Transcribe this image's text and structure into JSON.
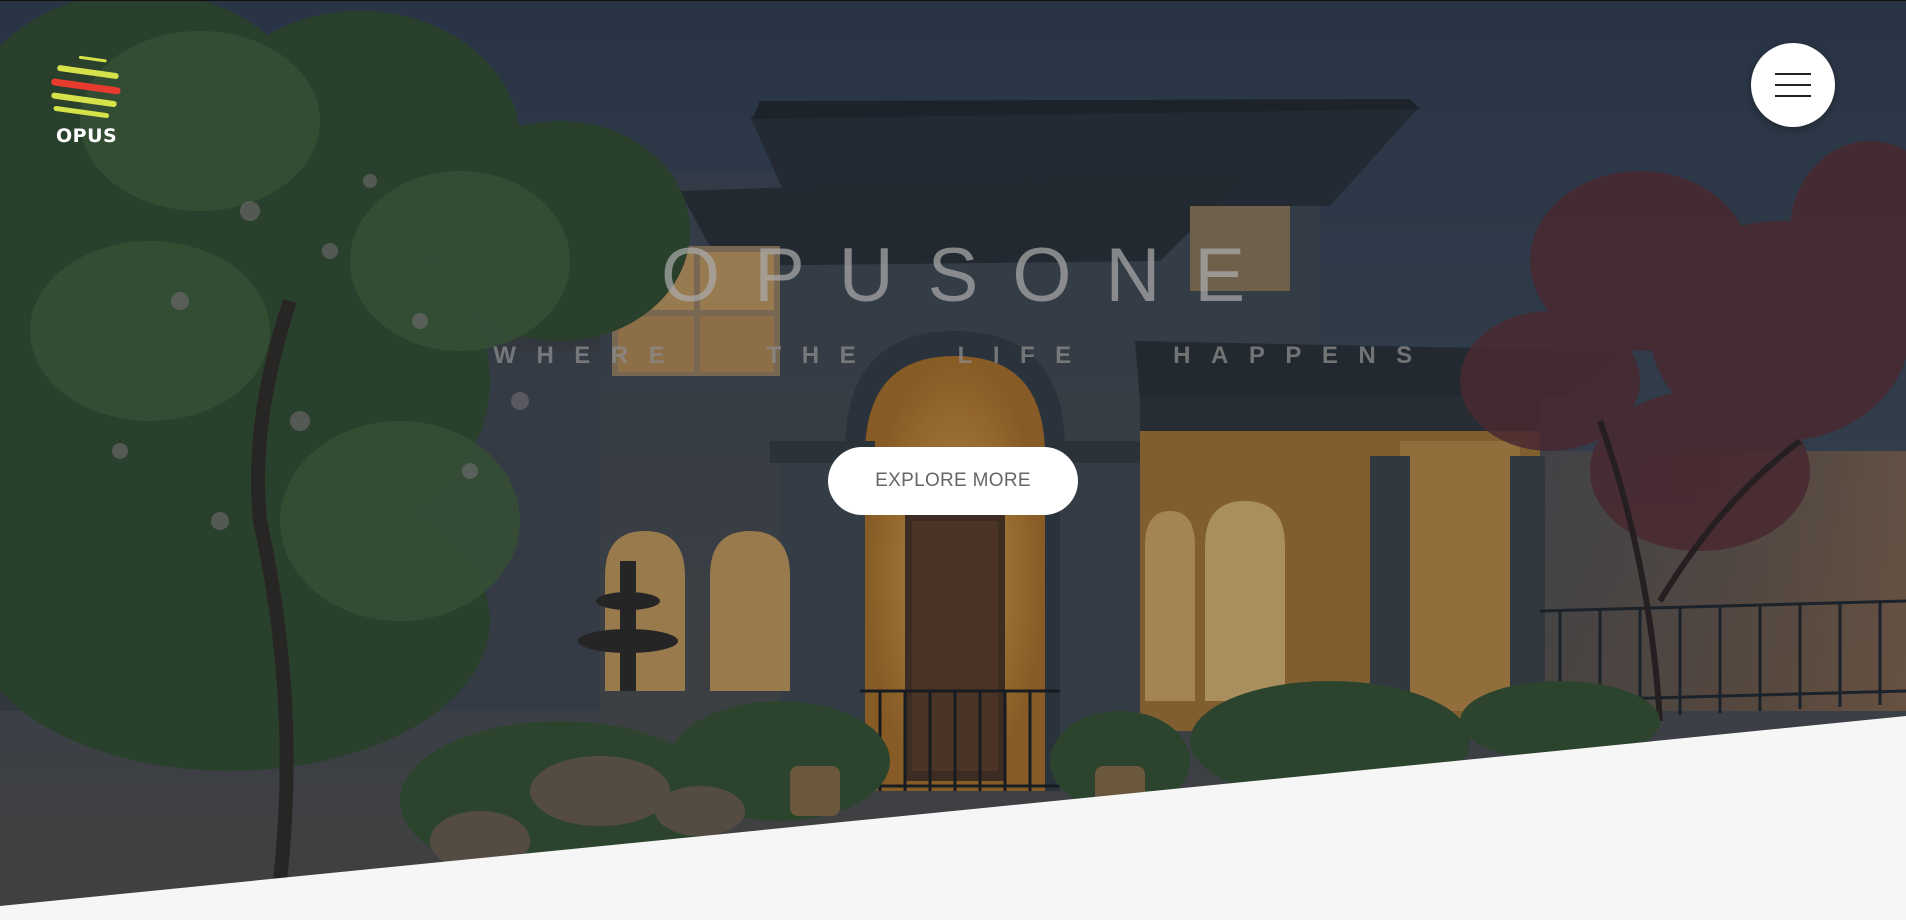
{
  "logo": {
    "wordmark": "OPUS",
    "stripe_colors": [
      "#d6e24a",
      "#e63b2e",
      "#d6e24a",
      "#e63b2e",
      "#d6e24a"
    ]
  },
  "menu": {
    "icon": "hamburger-menu-icon"
  },
  "hero": {
    "title": "OPUSONE",
    "subtitle": "WHERE THE LIFE HAPPENS",
    "cta_label": "EXPLORE MORE",
    "background": "house-at-dusk-photo"
  },
  "colors": {
    "overlay": "#1c2733",
    "section_bg": "#f6f6f6",
    "window_glow": "#e0a040"
  }
}
